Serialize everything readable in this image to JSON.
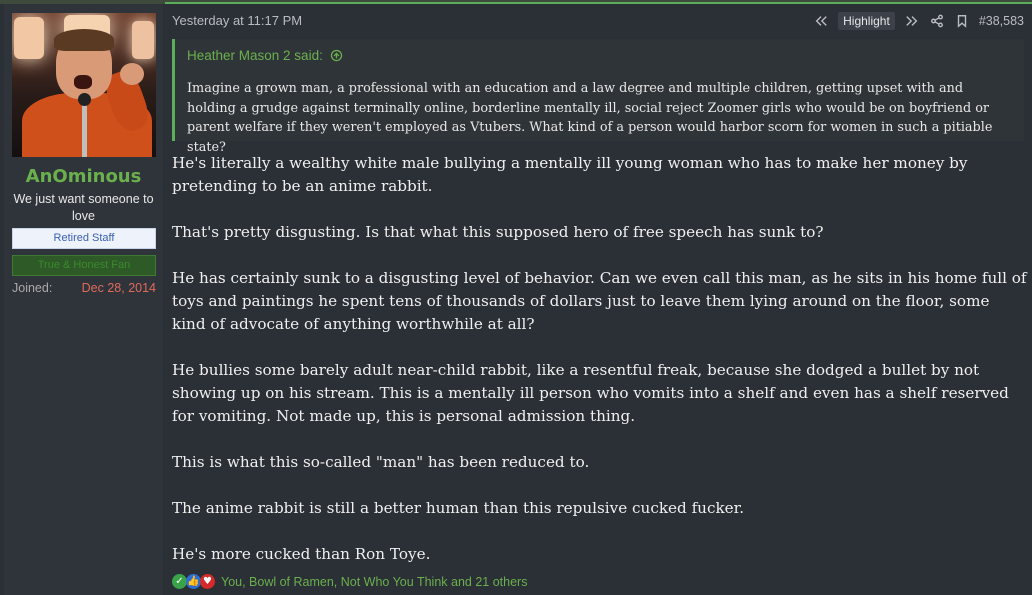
{
  "user": {
    "username": "AnOminous",
    "title": "We just want someone to love",
    "banners": [
      "Retired Staff",
      "True & Honest Fan"
    ],
    "joined_label": "Joined:",
    "joined_value": "Dec 28, 2014"
  },
  "post": {
    "date": "Yesterday at 11:17 PM",
    "actions": {
      "highlight_label": "Highlight",
      "post_number": "#38,583"
    },
    "quote": {
      "author_said": "Heather Mason 2 said:",
      "text": "Imagine a grown man, a professional with an education and a law degree and multiple children, getting upset with and holding a grudge against terminally online, borderline mentally ill, social reject Zoomer girls who would be on boyfriend or parent welfare if they weren't employed as Vtubers. What kind of a person would harbor scorn for women in such a pitiable state?"
    },
    "paragraphs": [
      "He's literally a wealthy white male bullying a mentally ill young woman who has to make her money by pretending to be an anime rabbit.",
      "That's pretty disgusting. Is that what this supposed hero of free speech has sunk to?",
      "He has certainly sunk to a disgusting level of behavior. Can we even call this man, as he sits in his home full of toys and paintings he spent tens of thousands of dollars just to leave them lying around on the floor, some kind of advocate of anything worthwhile at all?",
      "He bullies some barely adult near-child rabbit, like a resentful freak, because she dodged a bullet by not showing up on his stream. This is a mentally ill person who vomits into a shelf and even has a shelf reserved for vomiting. Not made up, this is personal admission thing.",
      "This is what this so-called \"man\" has been reduced to.",
      "The anime rabbit is still a better human than this repulsive cucked fucker.",
      "He's more cucked than Ron Toye."
    ],
    "reactions": {
      "icons": [
        "check-icon",
        "thumbs-up-icon",
        "heart-icon"
      ],
      "names": "You, Bowl of Ramen, Not Who You Think and 21 others"
    }
  },
  "colors": {
    "accent_green": "#6ab04c",
    "background": "#2b2f36",
    "joined_date": "#e06a5a"
  }
}
